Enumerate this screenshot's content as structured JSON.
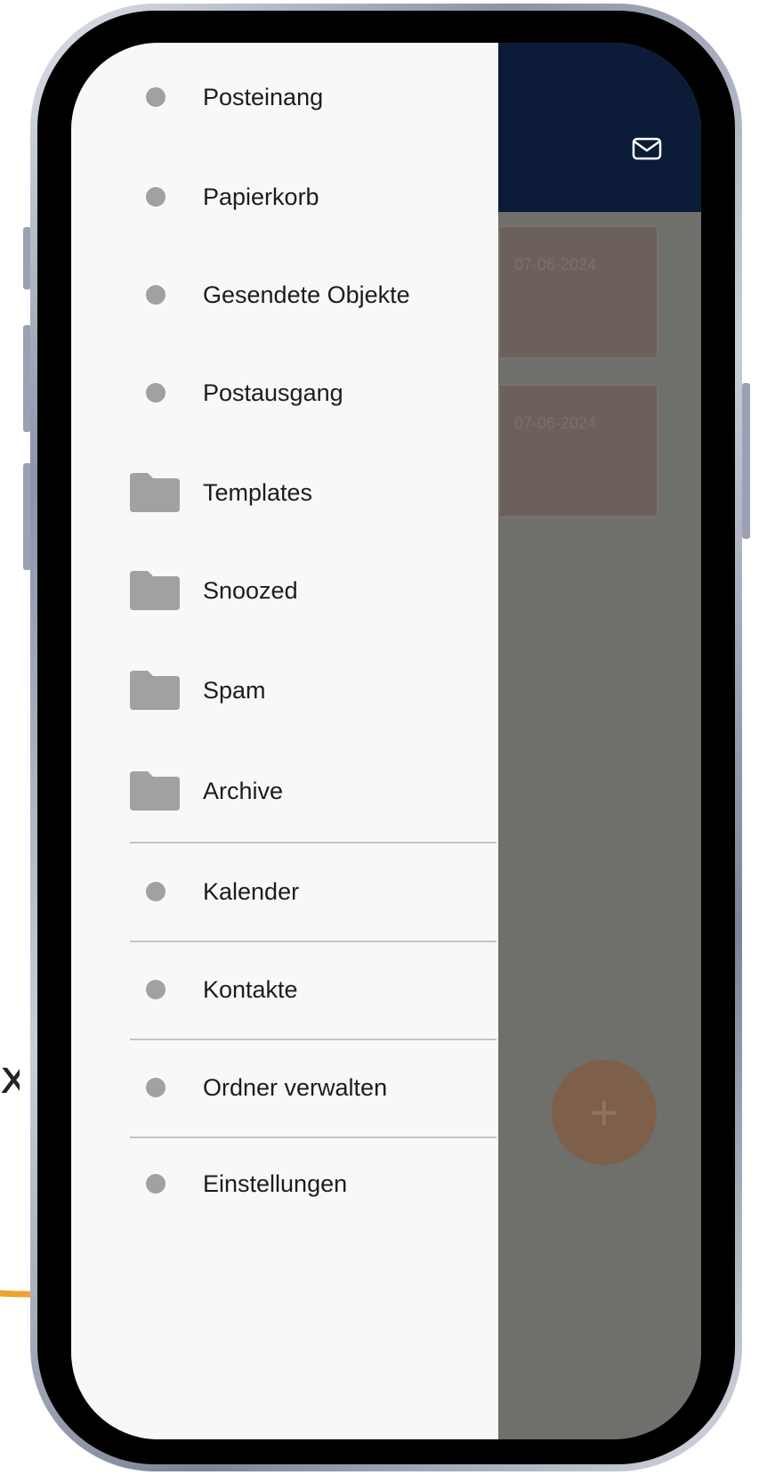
{
  "app": {
    "mail_dates": [
      "07-06-2024",
      "07-06-2024"
    ],
    "fab_label": "+"
  },
  "drawer": {
    "items": [
      {
        "label": "Posteinang",
        "icon": "dot-icon"
      },
      {
        "label": "Papierkorb",
        "icon": "dot-icon"
      },
      {
        "label": "Gesendete Objekte",
        "icon": "dot-icon"
      },
      {
        "label": "Postausgang",
        "icon": "dot-icon"
      },
      {
        "label": "Templates",
        "icon": "folder-icon"
      },
      {
        "label": "Snoozed",
        "icon": "folder-icon"
      },
      {
        "label": "Spam",
        "icon": "folder-icon"
      },
      {
        "label": "Archive",
        "icon": "folder-icon"
      },
      {
        "label": "Kalender",
        "icon": "dot-icon"
      },
      {
        "label": "Kontakte",
        "icon": "dot-icon"
      },
      {
        "label": "Ordner verwalten",
        "icon": "dot-icon"
      },
      {
        "label": "Einstellungen",
        "icon": "dot-icon"
      }
    ]
  },
  "annotation": {
    "mark": "x"
  },
  "colors": {
    "header": "#0c1b38",
    "drawer_bg": "#f6f8f9",
    "icon_grey": "#a1a1a0",
    "annotation_orange": "#f0a22e",
    "overlay": "#6f706b"
  }
}
